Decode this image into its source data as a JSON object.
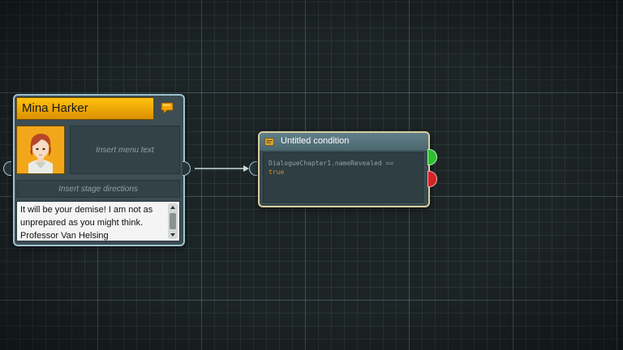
{
  "dialogue_node": {
    "speaker": "Mina Harker",
    "menu_text_placeholder": "Insert menu text",
    "stage_directions_placeholder": "Insert stage directions",
    "dialogue_text": "It will be your demise! I am not as unprepared as you might think. Professor Van Helsing",
    "icon": "speech-bubble-icon",
    "header_color": "#f2a900"
  },
  "condition_node": {
    "title": "Untitled condition",
    "expression_variable": "DialogueChapter1.nameRevealed ==",
    "expression_value": "true",
    "icon": "condition-icon",
    "outputs": [
      {
        "name": "true",
        "color": "#2fbf2f"
      },
      {
        "name": "false",
        "color": "#d42424"
      }
    ]
  }
}
